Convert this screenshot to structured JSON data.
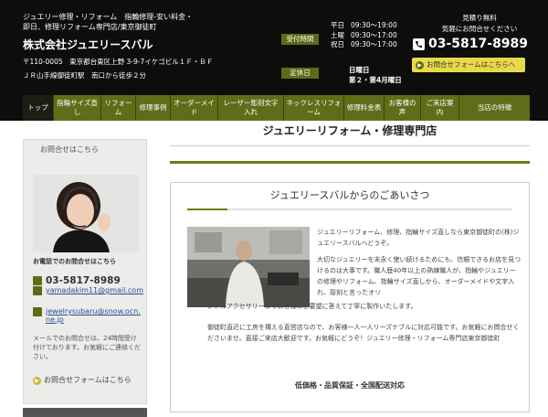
{
  "header": {
    "tagline_line1": "ジュエリー修理・リフォーム　指輪修理-安い料金・",
    "tagline_line2": "即日、修理リフォーム専門店/東京御徒町",
    "company": "株式会社ジュエリースバル",
    "address_line1": "〒110-0005　東京都台東区上野 3-9-7イケゴビル１Ｆ・ＢＦ",
    "address_line2": "ＪＲ山手線御徒町駅　南口から徒歩２分",
    "hours_label": "受付時間",
    "hours": [
      {
        "day": "平日",
        "time": "09:30～19:00"
      },
      {
        "day": "土曜",
        "time": "09:30～17:00"
      },
      {
        "day": "祝日",
        "time": "09:30～17:00"
      }
    ],
    "closed_label": "定休日",
    "closed_line1": "日曜日",
    "closed_line2": "第２・第4月曜日",
    "quote_line1": "見積り無料",
    "quote_line2": "気軽にお問合せください",
    "phone": "03-5817-8989",
    "contact_button": "お問合せフォームはこちらへ"
  },
  "nav": {
    "items": [
      {
        "label": "トップ"
      },
      {
        "label": "指輪サイズ直し"
      },
      {
        "label": "リフォーム"
      },
      {
        "label": "修理事例"
      },
      {
        "label": "オーダーメイド"
      },
      {
        "label": "レーザー彫刻文字入れ"
      },
      {
        "label": "ネックレスリフォーム"
      },
      {
        "label": "修理料金表"
      },
      {
        "label": "お客様の声"
      },
      {
        "label": "ご来店案内"
      },
      {
        "label": "当店の特徴"
      }
    ]
  },
  "sidebar": {
    "title": "お問合せはこちら",
    "phone_heading": "お電話でのお問合せはこちら",
    "phone": "03-5817-8989",
    "email1": "yamadakim11@gmail.com",
    "email2": "jewelrysubaru@snow.ocn.ne.jp",
    "note": "メールでのお問合せは、24時間受け付けております。お気軽にご連絡ください。",
    "form_link": "お問合せフォームはこちら"
  },
  "main": {
    "page_title": "ジュエリーリフォーム・修理専門店",
    "greeting_title": "ジュエリースバルからのごあいさつ",
    "text1": "ジュエリーリフォーム、修理、指輪サイズ直しなら東京御徒町の(株)ジュエリースバルへどうぞ。",
    "text2": "大切なジュエリーを末永く使い続けるためにも、信頼できるお店を見つけるのは大事です。職人歴40年以上の熟練職人が、指輪やジュエリーの修理やリフォーム、指輪サイズ直しから、オーダーメイドや文字入れ、彫刻と言ったオリ",
    "text2b": "ジナルアクセサリーまでお客様のご要望に答えて丁寧に製作いたします。",
    "text3": "御徒町直近に工房を構える直営店なので、お客様一人一人リーズナブルに対応可能です。お気軽にお問合せくださいませ。直接ご来店大歓迎です。お気軽にどうぞ！ジュエリー修理・リフォーム専門店東京御徒町",
    "bottom_line": "低価格・品質保証・全国配送対応"
  },
  "colors": {
    "header_bg": "#0d0d0b",
    "nav_green": "#606d18",
    "accent_yellow": "#e8d94a"
  }
}
